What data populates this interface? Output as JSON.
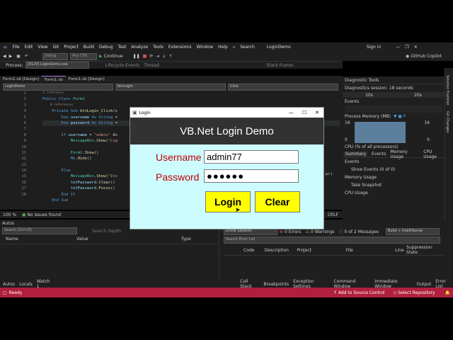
{
  "menu": {
    "items": [
      "File",
      "Edit",
      "View",
      "Git",
      "Project",
      "Build",
      "Debug",
      "Test",
      "Analyze",
      "Tools",
      "Extensions",
      "Window",
      "Help"
    ],
    "search_label": "Search",
    "solution_name": "LoginDemo",
    "signin": "Sign in"
  },
  "toolbar": {
    "config": "Debug",
    "platform": "Any CPU",
    "continue_label": "Continue",
    "process_label": "Process:",
    "process_value": "[9120] LoginDemo.exe",
    "lifecycle": "Lifecycle Events",
    "thread": "Thread:",
    "stackframe": "Stack Frame:",
    "copilot": "GitHub Copilot"
  },
  "tabs": [
    {
      "label": "Form2.vb [Design]"
    },
    {
      "label": "Form1.vb"
    },
    {
      "label": "Form1.vb [Design]"
    }
  ],
  "editor": {
    "project_dropdown": "LoginDemo",
    "object_dropdown": "btnLogin",
    "event_dropdown": "Click",
    "line_numbers": [
      "1",
      "2",
      "3",
      "4",
      "5",
      "6",
      "7",
      "8",
      "9",
      "10",
      "11",
      "12",
      "13",
      "14",
      "15",
      "16",
      "17",
      "18"
    ],
    "refs1": "1 reference",
    "refs0": "0 references",
    "zoom": "100 %",
    "issues": "No issues found",
    "crlf": "CRLF"
  },
  "diagnostics": {
    "title": "Diagnostic Tools",
    "session": "Diagnostics session: 18 seconds",
    "t10": "10s",
    "t20": "20s",
    "events": "Events",
    "process_memory": "Process Memory (MB)",
    "mem_top": "16",
    "mem_bottom": "0",
    "cpu": "CPU (% of all processors)",
    "tabs": [
      "Summary",
      "Events",
      "Memory Usage",
      "CPU Usage"
    ],
    "events_section": "Events",
    "show_events": "Show Events (0 of 0)",
    "memory_usage": "Memory Usage",
    "take_snapshot": "Take Snapshot",
    "cpu_usage": "CPU Usage"
  },
  "autos": {
    "title": "Autos",
    "search": "Search (Ctrl+E)",
    "search_depth": "Search Depth:",
    "cols": [
      "Name",
      "Value",
      "Type"
    ]
  },
  "errorlist": {
    "scope": "Entire Solution",
    "errors": "0 Errors",
    "warnings": "0 Warnings",
    "messages": "0 of 2 Messages",
    "build": "Build + IntelliSense",
    "search": "Search Error List",
    "cols": [
      "Code",
      "Description",
      "Project",
      "File",
      "Line",
      "Suppression State"
    ]
  },
  "bottom_tabs_left": [
    "Autos",
    "Locals",
    "Watch 1"
  ],
  "bottom_tabs_right": [
    "Call Stack",
    "Breakpoints",
    "Exception Settings",
    "Command Window",
    "Immediate Window",
    "Output",
    "Error List"
  ],
  "status": {
    "ready": "Ready",
    "source_control": "Add to Source Control",
    "repository": "Select Repository"
  },
  "dialog": {
    "title": "Login",
    "header": "VB.Net Login Demo",
    "username_label": "Username",
    "username_value": "admin77",
    "password_label": "Password",
    "password_value": "●●●●●●",
    "login_button": "Login",
    "clear_button": "Clear"
  },
  "side_strip": [
    "Solution Explorer",
    "Git Changes"
  ],
  "colors": {
    "statusbar": "#b0203d",
    "dialog_bg": "#cdfcff",
    "header_bg": "#323232",
    "label": "#c00000",
    "button": "#ffff00"
  }
}
